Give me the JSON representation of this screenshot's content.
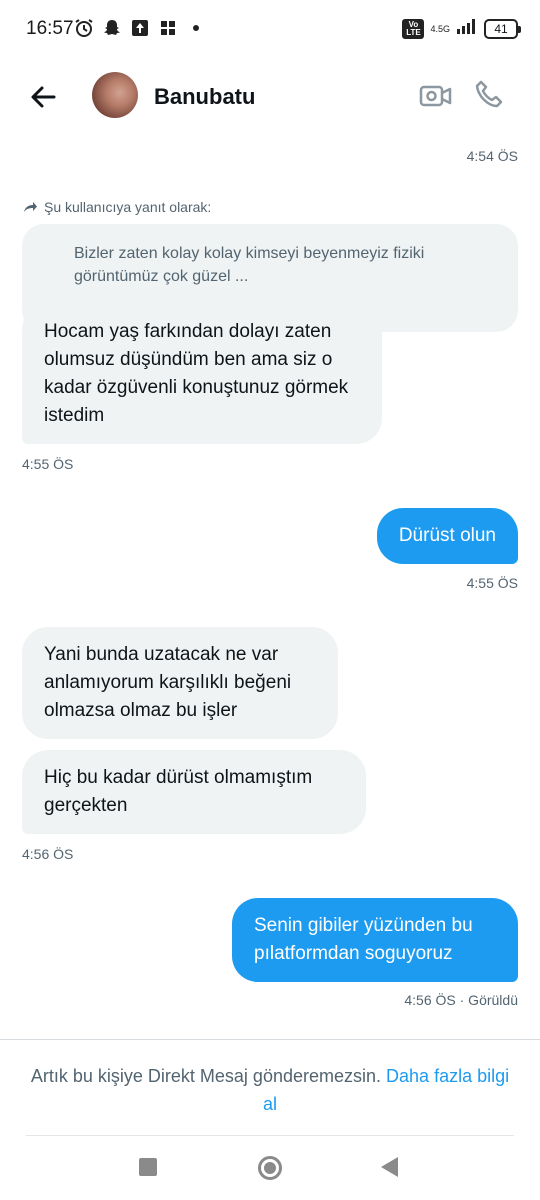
{
  "status_bar": {
    "time": "16:57",
    "network": "4.5G",
    "volte": "Vo LTE",
    "battery": "41"
  },
  "header": {
    "name": "Banubatu"
  },
  "messages": {
    "ts_top": "4:54 ÖS",
    "reply_label": "Şu kullanıcıya yanıt olarak:",
    "quoted_text": "Bizler zaten kolay kolay kimseyi beyenmeyiz fiziki görüntümüz çok güzel ...",
    "m1": "Hocam yaş farkından dolayı zaten olumsuz düşündüm ben ama siz o kadar özgüvenli konuştunuz görmek istedim",
    "ts_m1": "4:55 ÖS",
    "m2": "Dürüst olun",
    "ts_m2": "4:55 ÖS",
    "m3": "Yani bunda uzatacak ne var anlamıyorum karşılıklı beğeni olmazsa olmaz bu işler",
    "m4": "Hiç bu kadar dürüst olmamıştım gerçekten",
    "ts_m4": "4:56 ÖS",
    "m5": "Senin gibiler yüzünden bu pılatformdan soguyoruz",
    "ts_m5": "4:56 ÖS · Görüldü"
  },
  "footer": {
    "notice": "Artık bu kişiye Direkt Mesaj gönderemezsin.",
    "link": "Daha fazla bilgi al"
  },
  "colors": {
    "accent": "#1d9bf0",
    "incoming_bubble": "#eff3f4",
    "muted_text": "#536471"
  }
}
